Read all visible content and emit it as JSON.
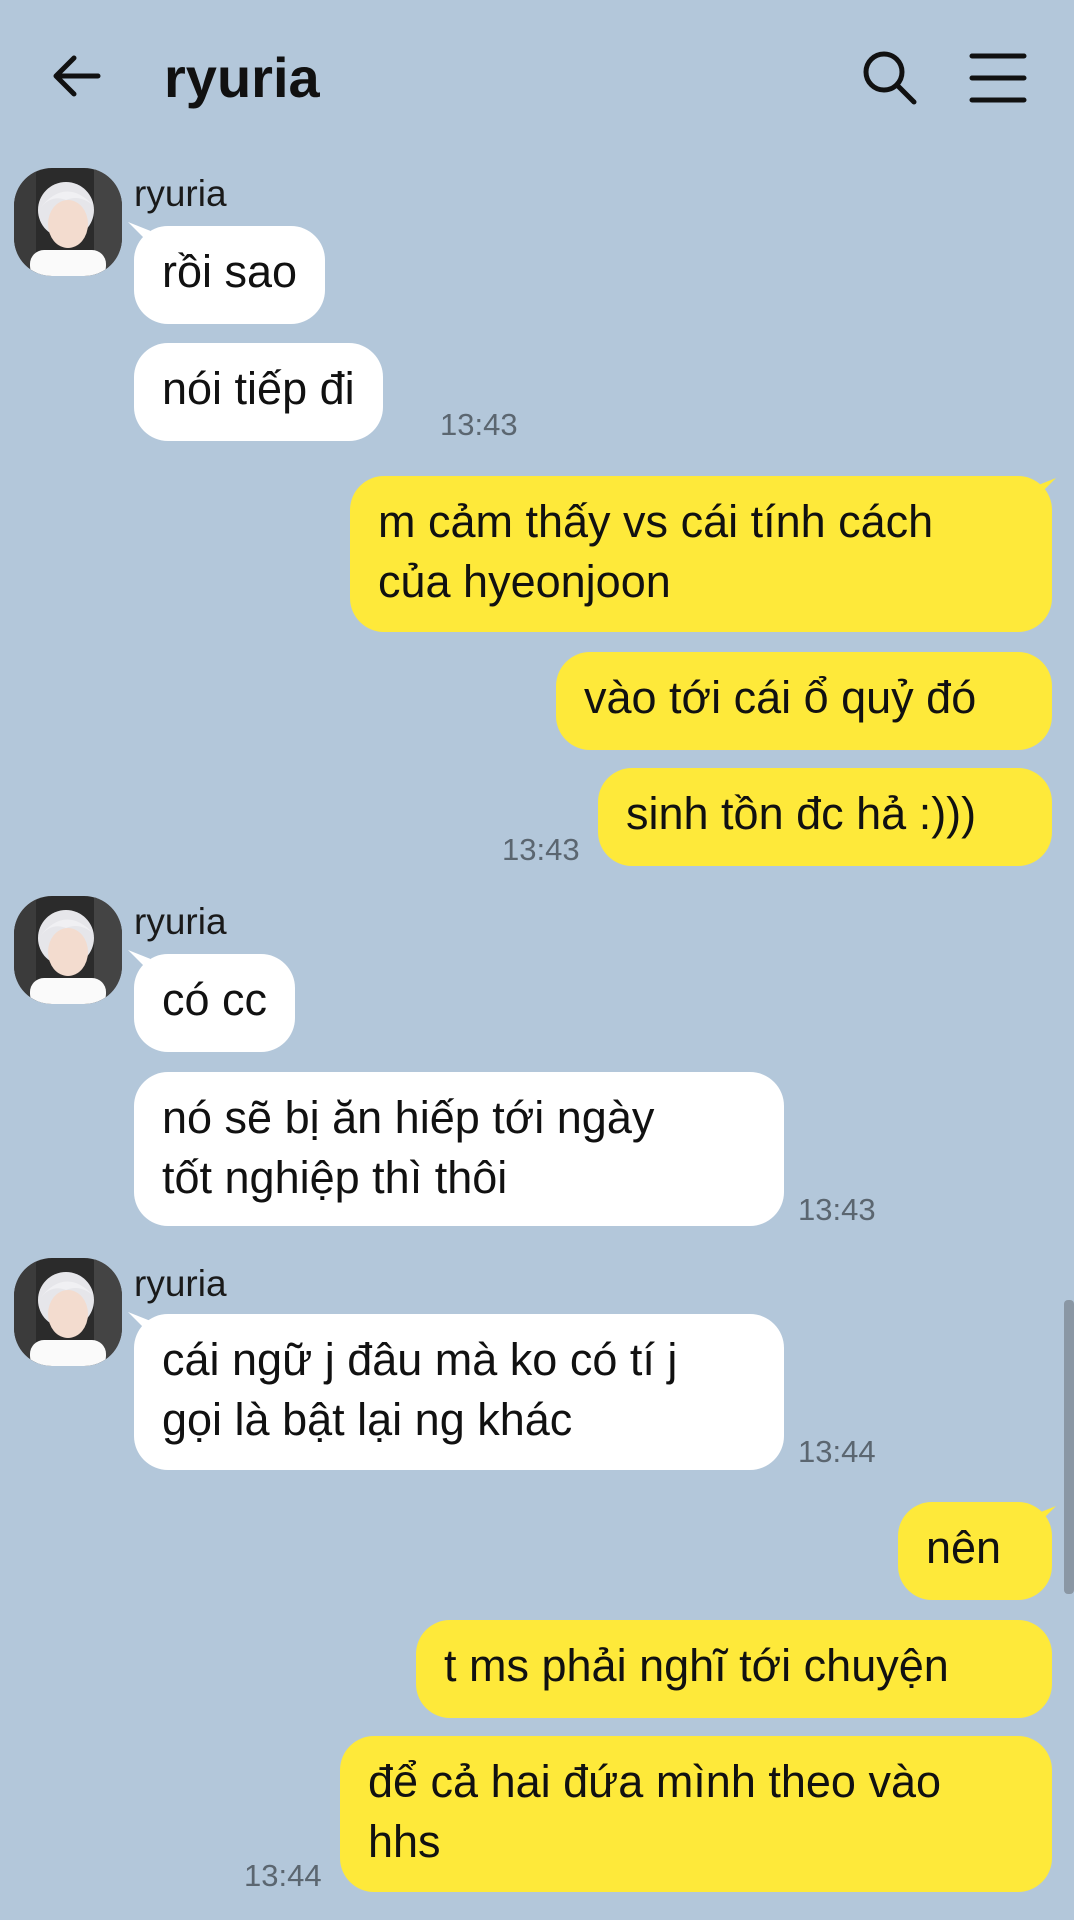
{
  "header": {
    "title": "ryuria",
    "back_icon": "arrow-left-icon",
    "search_icon": "search-icon",
    "menu_icon": "hamburger-menu-icon"
  },
  "colors": {
    "background": "#b3c7da",
    "incoming_bubble": "#ffffff",
    "outgoing_bubble": "#fee93a",
    "timestamp": "#5b6670"
  },
  "messages": [
    {
      "sender": "ryuria",
      "text": "rồi sao"
    },
    {
      "text": "nói tiếp đi",
      "time": "13:43"
    },
    {
      "line1": "m cảm thấy vs cái tính cách",
      "line2": "của hyeonjoon"
    },
    {
      "text": "vào tới cái ổ quỷ đó"
    },
    {
      "text": "sinh tồn đc hả :)))",
      "time": "13:43"
    },
    {
      "sender": "ryuria",
      "text": "có cc"
    },
    {
      "line1": "nó sẽ bị ăn hiếp tới ngày",
      "line2": "tốt nghiệp thì thôi",
      "time": "13:43"
    },
    {
      "sender": "ryuria",
      "line1": "cái ngữ j đâu mà ko có tí j",
      "line2": "gọi là bật lại ng khác",
      "time": "13:44"
    },
    {
      "text": "nên"
    },
    {
      "text": "t ms phải nghĩ tới chuyện"
    },
    {
      "line1": "để cả hai đứa mình theo vào",
      "line2": "hhs",
      "time": "13:44"
    }
  ]
}
